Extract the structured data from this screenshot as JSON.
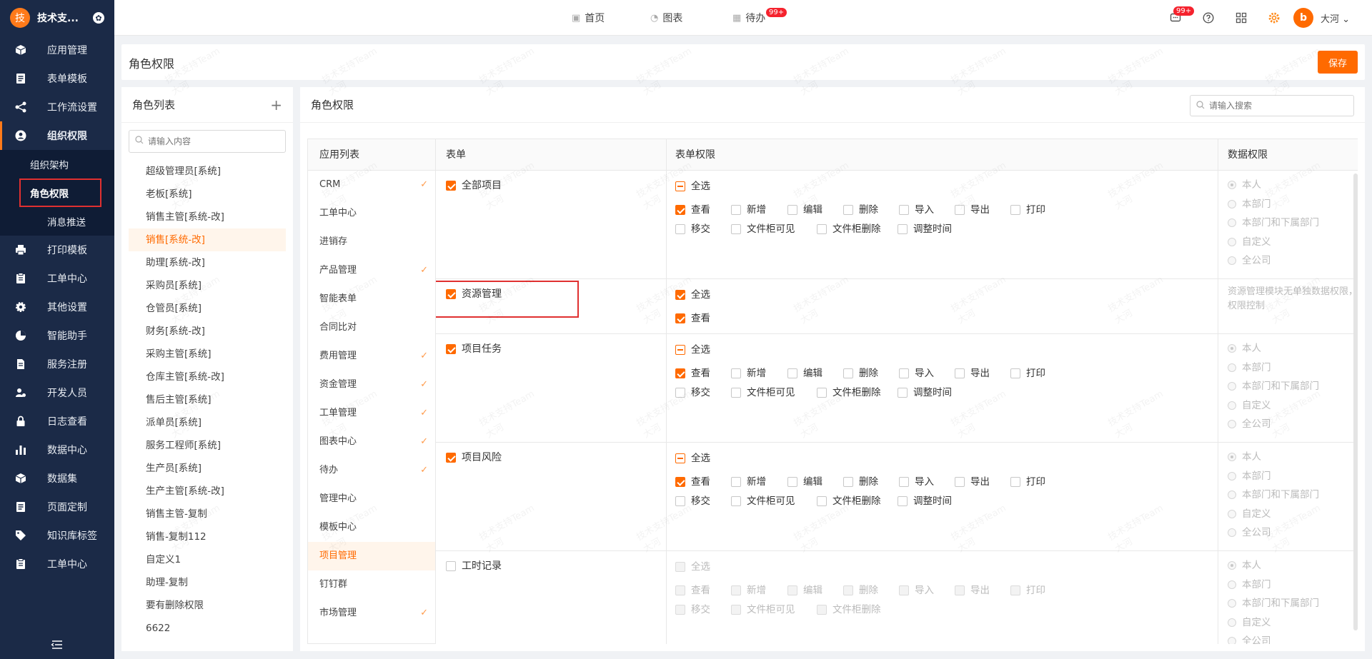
{
  "app": {
    "brand_letter": "技",
    "brand_name": "技术支...",
    "user_name": "大河",
    "avatar_letter": "b",
    "accent": "#ff6a00"
  },
  "sidebar": {
    "items": [
      {
        "label": "应用管理",
        "icon": "cube-icon"
      },
      {
        "label": "表单模板",
        "icon": "form-icon"
      },
      {
        "label": "工作流设置",
        "icon": "workflow-icon"
      },
      {
        "label": "组织权限",
        "icon": "user-circle-icon"
      },
      {
        "label": "打印模板",
        "icon": "printer-icon"
      },
      {
        "label": "工单中心",
        "icon": "clipboard-icon"
      },
      {
        "label": "其他设置",
        "icon": "gear-icon"
      },
      {
        "label": "智能助手",
        "icon": "pie-icon"
      },
      {
        "label": "服务注册",
        "icon": "document-icon"
      },
      {
        "label": "开发人员",
        "icon": "developer-icon"
      },
      {
        "label": "日志查看",
        "icon": "lock-icon"
      },
      {
        "label": "数据中心",
        "icon": "bar-chart-icon"
      },
      {
        "label": "数据集",
        "icon": "cube-icon"
      },
      {
        "label": "页面定制",
        "icon": "form-icon"
      },
      {
        "label": "知识库标签",
        "icon": "tag-icon"
      },
      {
        "label": "工单中心",
        "icon": "clipboard-icon"
      }
    ],
    "sub_items": [
      "组织架构",
      "角色权限",
      "消息推送"
    ]
  },
  "topnav": {
    "home": "首页",
    "charts": "图表",
    "todo": "待办",
    "todo_badge": "99+",
    "msg_badge": "99+"
  },
  "header": {
    "title": "角色权限",
    "save_label": "保存"
  },
  "role_panel": {
    "title": "角色列表",
    "search_placeholder": "请输入内容",
    "roles": [
      "超级管理员[系统]",
      "老板[系统]",
      "销售主管[系统-改]",
      "销售[系统-改]",
      "助理[系统-改]",
      "采购员[系统]",
      "仓管员[系统]",
      "财务[系统-改]",
      "采购主管[系统]",
      "仓库主管[系统-改]",
      "售后主管[系统]",
      "派单员[系统]",
      "服务工程师[系统]",
      "生产员[系统]",
      "生产主管[系统-改]",
      "销售主管-复制",
      "销售-复制112",
      "自定义1",
      "助理-复制",
      "要有删除权限",
      "6622"
    ],
    "selected_index": 3
  },
  "perm_panel": {
    "title": "角色权限",
    "search_placeholder": "请输入搜索",
    "col_app": "应用列表",
    "col_form": "表单",
    "col_form_perm": "表单权限",
    "col_data_perm": "数据权限",
    "apps": [
      {
        "label": "CRM",
        "checked": true
      },
      {
        "label": "工单中心",
        "checked": false
      },
      {
        "label": "进销存",
        "checked": false
      },
      {
        "label": "产品管理",
        "checked": true
      },
      {
        "label": "智能表单",
        "checked": false
      },
      {
        "label": "合同比对",
        "checked": false
      },
      {
        "label": "费用管理",
        "checked": true
      },
      {
        "label": "资金管理",
        "checked": true
      },
      {
        "label": "工单管理",
        "checked": true
      },
      {
        "label": "图表中心",
        "checked": true
      },
      {
        "label": "待办",
        "checked": true
      },
      {
        "label": "管理中心",
        "checked": false
      },
      {
        "label": "模板中心",
        "checked": false
      },
      {
        "label": "项目管理",
        "checked": false
      },
      {
        "label": "钉钉群",
        "checked": false
      },
      {
        "label": "市场管理",
        "checked": true
      }
    ],
    "selected_app_index": 13,
    "perm_labels": {
      "select_all": "全选",
      "view": "查看",
      "add": "新增",
      "edit": "编辑",
      "delete": "删除",
      "import": "导入",
      "export": "导出",
      "print": "打印",
      "transfer": "移交",
      "cabinet_visible": "文件柜可见",
      "cabinet_delete": "文件柜删除",
      "adjust_time": "调整时间"
    },
    "data_scopes": [
      "本人",
      "本部门",
      "本部门和下属部门",
      "自定义",
      "全公司"
    ],
    "forms": [
      {
        "name": "全部项目",
        "checked": true
      },
      {
        "name": "资源管理",
        "checked": true,
        "note": "资源管理模块无单独数据权限，根据项目任务和项目风险的数据权限控制"
      },
      {
        "name": "项目任务",
        "checked": true
      },
      {
        "name": "项目风险",
        "checked": true
      },
      {
        "name": "工时记录",
        "checked": false
      }
    ]
  },
  "watermark": {
    "line1": "技术支持Team",
    "line2": "大河"
  }
}
